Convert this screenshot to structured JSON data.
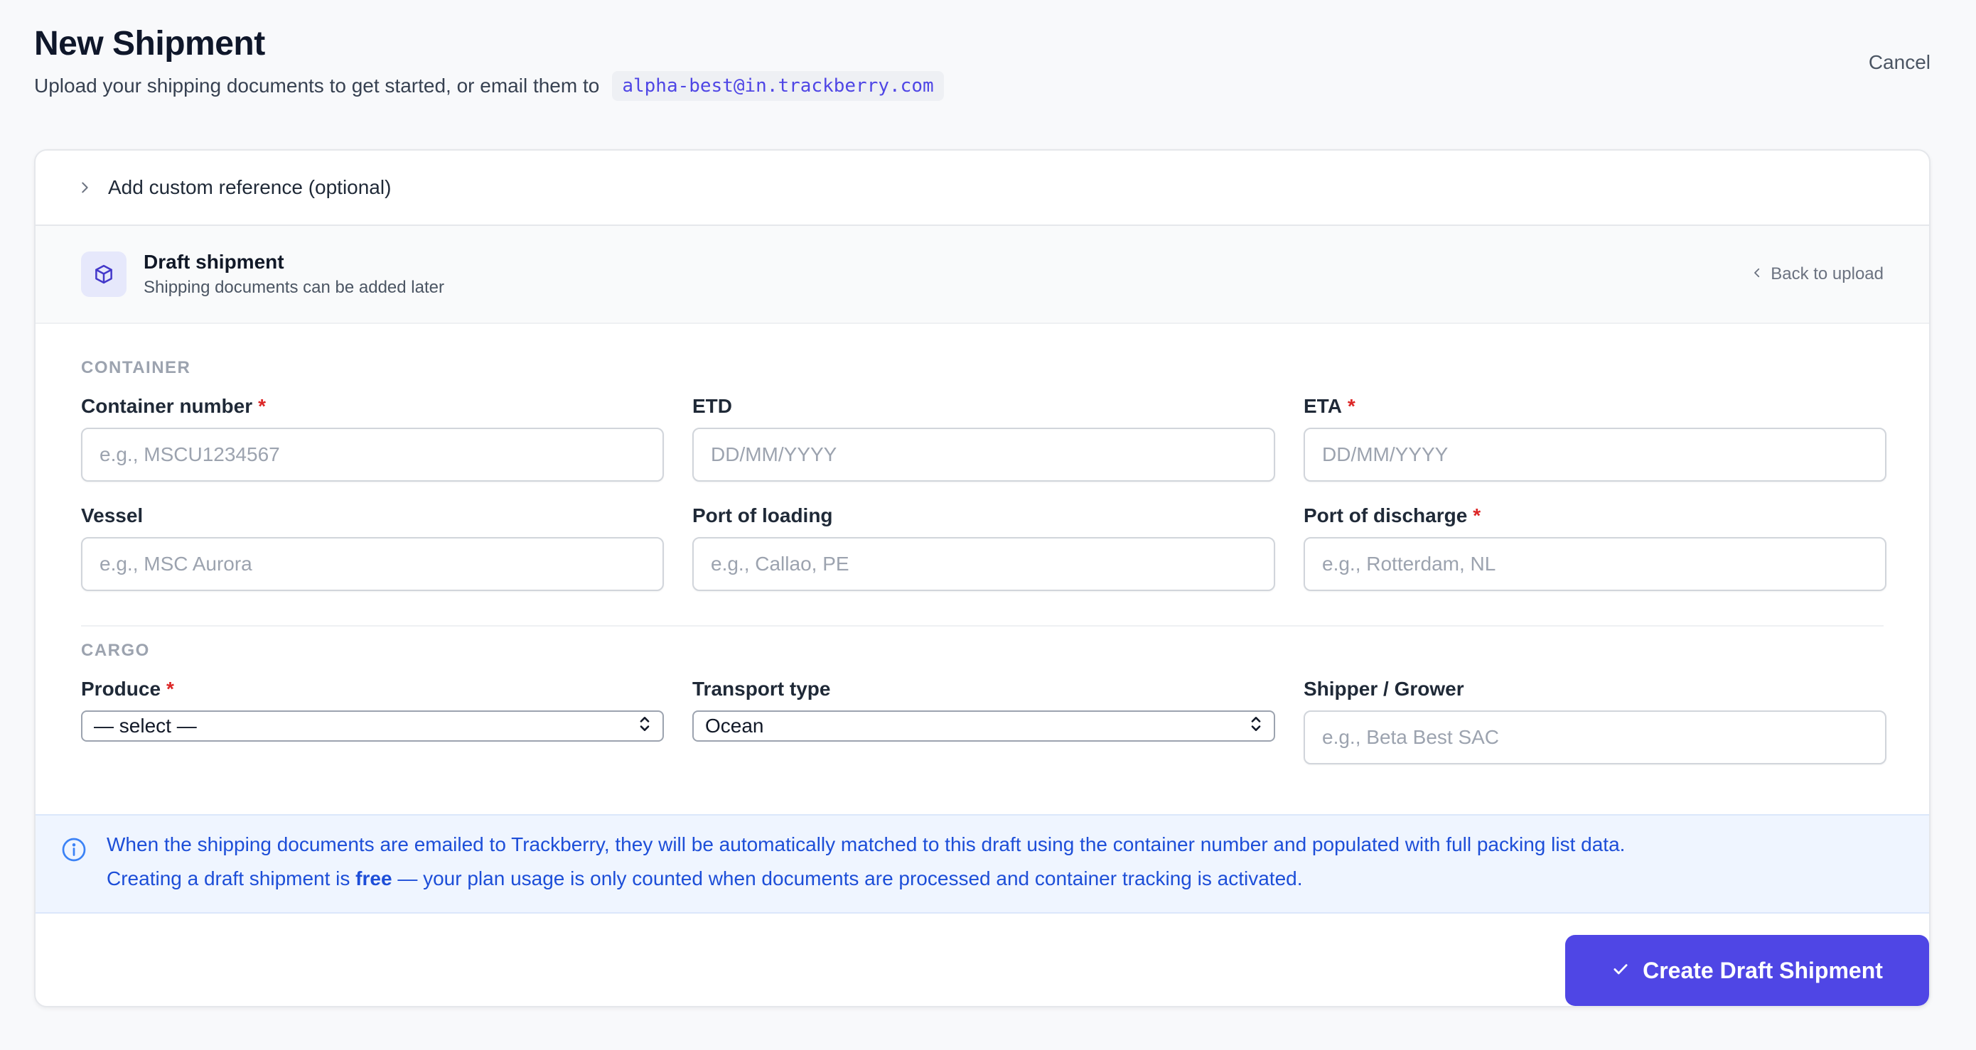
{
  "header": {
    "title": "New Shipment",
    "subtitle": "Upload your shipping documents to get started, or email them to",
    "email": "alpha-best@in.trackberry.com",
    "cancel_label": "Cancel"
  },
  "reference": {
    "label": "Add custom reference (optional)"
  },
  "draft": {
    "title": "Draft shipment",
    "subtitle": "Shipping documents can be added later",
    "back_label": "Back to upload"
  },
  "container_section": {
    "label": "CONTAINER",
    "fields": {
      "container_number": {
        "label": "Container number",
        "placeholder": "e.g., MSCU1234567",
        "required": "*"
      },
      "etd": {
        "label": "ETD",
        "placeholder": "DD/MM/YYYY"
      },
      "eta": {
        "label": "ETA",
        "placeholder": "DD/MM/YYYY",
        "required": "*"
      },
      "vessel": {
        "label": "Vessel",
        "placeholder": "e.g., MSC Aurora"
      },
      "port_loading": {
        "label": "Port of loading",
        "placeholder": "e.g., Callao, PE"
      },
      "port_discharge": {
        "label": "Port of discharge",
        "placeholder": "e.g., Rotterdam, NL",
        "required": "*"
      }
    }
  },
  "cargo_section": {
    "label": "CARGO",
    "fields": {
      "produce": {
        "label": "Produce",
        "value": "— select —",
        "required": "*"
      },
      "transport_type": {
        "label": "Transport type",
        "value": "Ocean"
      },
      "shipper": {
        "label": "Shipper / Grower",
        "placeholder": "e.g., Beta Best SAC"
      }
    }
  },
  "info": {
    "line1": "When the shipping documents are emailed to Trackberry, they will be automatically matched to this draft using the container number and populated with full packing list data.",
    "line2_prefix": "Creating a draft shipment is",
    "line2_bold": "free",
    "line2_suffix": "— your plan usage is only counted when documents are processed and container tracking is activated."
  },
  "actions": {
    "create_label": "Create Draft Shipment"
  },
  "icons": {
    "reference_chevron": "chevron-right-icon",
    "draft": "package-icon",
    "back": "chevron-left-icon",
    "info": "info-icon",
    "select": "chevron-up-down-icon",
    "create": "check-icon"
  },
  "colors": {
    "accent": "#4f46e5",
    "required": "#dc2626",
    "info_text": "#1d4ed8",
    "info_bg": "#eff5ff"
  }
}
